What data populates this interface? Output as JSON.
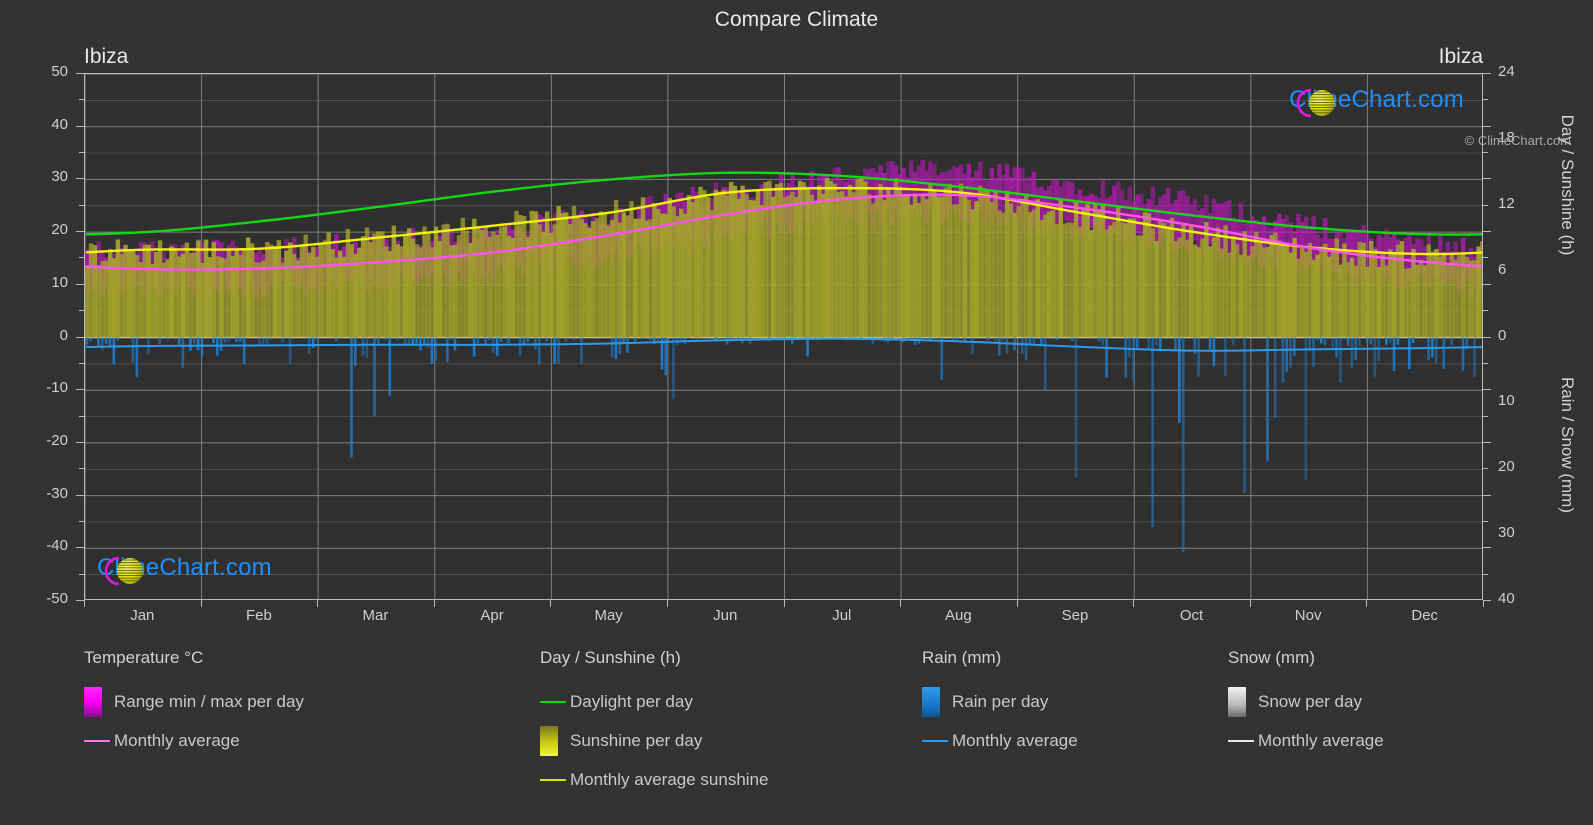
{
  "header": {
    "title": "Compare Climate",
    "location_left": "Ibiza",
    "location_right": "Ibiza"
  },
  "watermark": {
    "text": "ClimeChart.com"
  },
  "footer": {
    "copyright": "© ClimeChart.com"
  },
  "colors": {
    "background": "#333333",
    "plot_background": "#303030",
    "grid": "#8d8d8d",
    "axis": "#b9b9b9",
    "text": "#cfcfcf",
    "daylight_green": "#14d814",
    "sunshine_yellow": "#f2f20c",
    "sunshine_fill": "#a3a32b",
    "temp_magenta": "#ff55ee",
    "temp_range": "#c217c2",
    "rain_blue": "#1f7fd0",
    "rain_line": "#2e9bea",
    "snow_white": "#dddddd",
    "logo_text": "#1e90ff",
    "logo_ring": "#e617e6",
    "logo_sphere": "#d4d40f"
  },
  "chart_data": {
    "type": "area",
    "title": "Compare Climate",
    "subtitle": "Ibiza",
    "xlabel": "",
    "grid": true,
    "legend_position": "bottom",
    "x_categories": [
      "Jan",
      "Feb",
      "Mar",
      "Apr",
      "May",
      "Jun",
      "Jul",
      "Aug",
      "Sep",
      "Oct",
      "Nov",
      "Dec"
    ],
    "axes": {
      "left": {
        "label": "Temperature °C",
        "ticks": [
          "50",
          "40",
          "30",
          "20",
          "10",
          "0",
          "-10",
          "-20",
          "-30",
          "-40",
          "-50"
        ],
        "range": [
          -50,
          50
        ],
        "minor_step": 5
      },
      "right_top": {
        "label": "Day / Sunshine (h)",
        "ticks": [
          "24",
          "18",
          "12",
          "6",
          "0"
        ],
        "range": [
          0,
          24
        ]
      },
      "right_bottom": {
        "label": "Rain / Snow (mm)",
        "ticks": [
          "0",
          "10",
          "20",
          "30",
          "40"
        ],
        "range": [
          0,
          40
        ]
      }
    },
    "series": [
      {
        "name": "Monthly average",
        "group": "Temperature °C",
        "type": "line",
        "color": "#ff55ee",
        "unit": "°C",
        "values": [
          13.0,
          13.1,
          14.3,
          16.2,
          19.5,
          23.4,
          26.3,
          27.0,
          24.6,
          21.2,
          17.0,
          14.3
        ]
      },
      {
        "name": "Range min per day",
        "group": "Temperature °C",
        "type": "range-low",
        "color": "#c217c2",
        "unit": "°C",
        "values": [
          9.0,
          9.0,
          10.2,
          12.0,
          15.3,
          19.1,
          22.0,
          22.8,
          20.4,
          17.2,
          13.0,
          10.3
        ]
      },
      {
        "name": "Range max per day",
        "group": "Temperature °C",
        "type": "range-high",
        "color": "#c217c2",
        "unit": "°C",
        "values": [
          16.0,
          16.2,
          17.6,
          19.6,
          23.0,
          27.2,
          30.2,
          31.0,
          28.4,
          25.0,
          20.5,
          17.5
        ]
      },
      {
        "name": "Daylight per day",
        "group": "Day / Sunshine (h)",
        "type": "line",
        "color": "#14d814",
        "unit": "h",
        "values": [
          9.6,
          10.6,
          11.9,
          13.3,
          14.4,
          15.0,
          14.7,
          13.7,
          12.4,
          11.1,
          10.0,
          9.4
        ]
      },
      {
        "name": "Monthly average sunshine",
        "group": "Day / Sunshine (h)",
        "type": "line",
        "color": "#f2f20c",
        "unit": "h",
        "values": [
          8.0,
          8.1,
          9.1,
          10.2,
          11.4,
          13.2,
          13.6,
          13.2,
          11.4,
          9.6,
          8.2,
          7.6
        ]
      },
      {
        "name": "Sunshine per day",
        "group": "Day / Sunshine (h)",
        "type": "bars",
        "color": "#a3a32b",
        "unit": "h",
        "values": [
          8.0,
          8.1,
          9.1,
          10.2,
          11.4,
          13.2,
          13.6,
          13.2,
          11.4,
          9.6,
          8.2,
          7.6
        ]
      },
      {
        "name": "Monthly average",
        "group": "Rain (mm)",
        "type": "line",
        "color": "#2e9bea",
        "unit": "mm",
        "values": [
          1.3,
          1.2,
          1.1,
          1.1,
          0.9,
          0.4,
          0.2,
          0.6,
          1.4,
          2.0,
          1.8,
          1.6
        ]
      },
      {
        "name": "Rain per day",
        "group": "Rain (mm)",
        "type": "bars",
        "color": "#1f7fd0",
        "unit": "mm",
        "values": [
          1.3,
          1.2,
          1.1,
          1.1,
          0.9,
          0.4,
          0.2,
          0.6,
          1.4,
          2.0,
          1.8,
          1.6
        ]
      },
      {
        "name": "Snow per day",
        "group": "Snow (mm)",
        "type": "bars",
        "color": "#dddddd",
        "unit": "mm",
        "values": [
          0,
          0,
          0,
          0,
          0,
          0,
          0,
          0,
          0,
          0,
          0,
          0
        ]
      }
    ]
  },
  "legend": {
    "columns": [
      {
        "heading": "Temperature °C",
        "entries": [
          {
            "label": "Range min / max per day",
            "marker": "swatch",
            "color": "#ff00ff"
          },
          {
            "label": "Monthly average",
            "marker": "line",
            "color": "#ff77ee"
          }
        ]
      },
      {
        "heading": "Day / Sunshine (h)",
        "entries": [
          {
            "label": "Daylight per day",
            "marker": "line",
            "color": "#14d814"
          },
          {
            "label": "Sunshine per day",
            "marker": "swatch",
            "color": "#f2f20c"
          },
          {
            "label": "Monthly average sunshine",
            "marker": "line",
            "color": "#e0e00c"
          }
        ]
      },
      {
        "heading": "Rain (mm)",
        "entries": [
          {
            "label": "Rain per day",
            "marker": "swatch",
            "color": "#1f8fe0"
          },
          {
            "label": "Monthly average",
            "marker": "line",
            "color": "#2e9bea"
          }
        ]
      },
      {
        "heading": "Snow (mm)",
        "entries": [
          {
            "label": "Snow per day",
            "marker": "swatch",
            "color": "#dddddd"
          },
          {
            "label": "Monthly average",
            "marker": "line",
            "color": "#e8e8e8"
          }
        ]
      }
    ]
  }
}
